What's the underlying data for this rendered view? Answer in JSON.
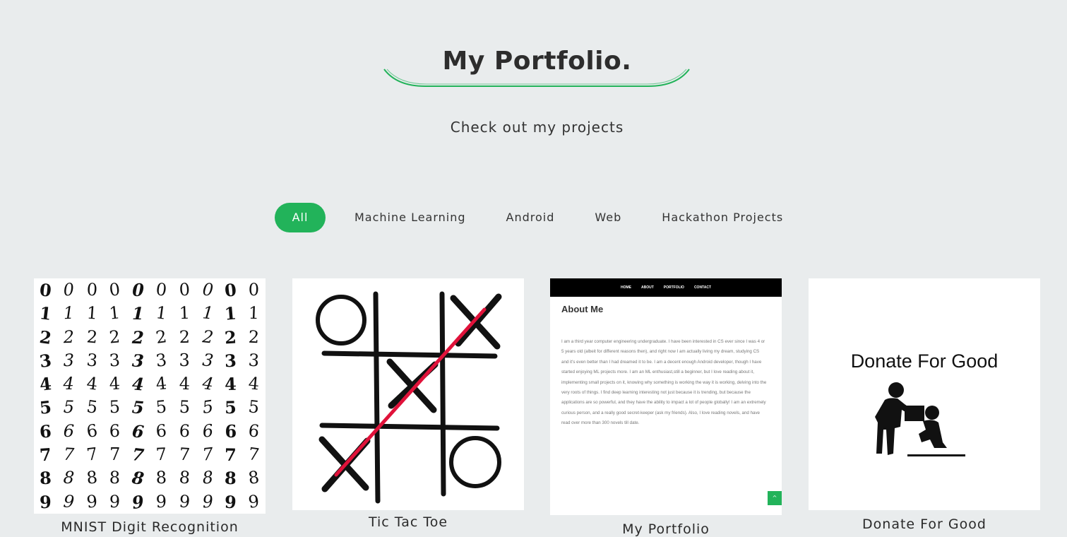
{
  "header": {
    "title": "My Portfolio.",
    "subtitle": "Check out my projects",
    "accent_color": "#22b35a"
  },
  "filters": [
    {
      "label": "All",
      "active": true
    },
    {
      "label": "Machine Learning",
      "active": false
    },
    {
      "label": "Android",
      "active": false
    },
    {
      "label": "Web",
      "active": false
    },
    {
      "label": "Hackathon Projects",
      "active": false
    }
  ],
  "projects": [
    {
      "title": "MNIST Digit Recognition",
      "image": "handwritten-digits-grid"
    },
    {
      "title": "Tic Tac Toe",
      "image": "tic-tac-toe-board"
    },
    {
      "title": "My Portfolio",
      "image": "portfolio-about-page-screenshot"
    },
    {
      "title": "Donate For Good",
      "image": "donate-icon"
    }
  ],
  "portfolio_preview": {
    "nav": [
      "HOME",
      "ABOUT",
      "PORTFOLIO",
      "CONTACT"
    ],
    "heading": "About Me",
    "body": "I am a third year computer engineering undergraduate. I have been interested in CS ever since I was 4 or 5 years old (albeit for different reasons then), and right now I am actually living my dream, studying CS and it's even better than I had dreamed it to be. I am a decent enough Android developer, though I have started enjoying ML projects more. I am an ML enthusiast,still a beginner, but I love reading about it, implementing small projects on it, knowing why something is working the way it is working, delving into the very roots of things. I find deep learning interesting not just because it is trending, but because the applications are so powerful, and they have the ability to impact a lot of people globally! I am an extremely curious person, and a really good secret-keeper (ask my friends). Also, I love reading novels, and have read over more than 300 novels till date.",
    "scroll_top": "^"
  },
  "donate_preview": {
    "text": "Donate For Good"
  },
  "mnist_digits": "0123456789"
}
